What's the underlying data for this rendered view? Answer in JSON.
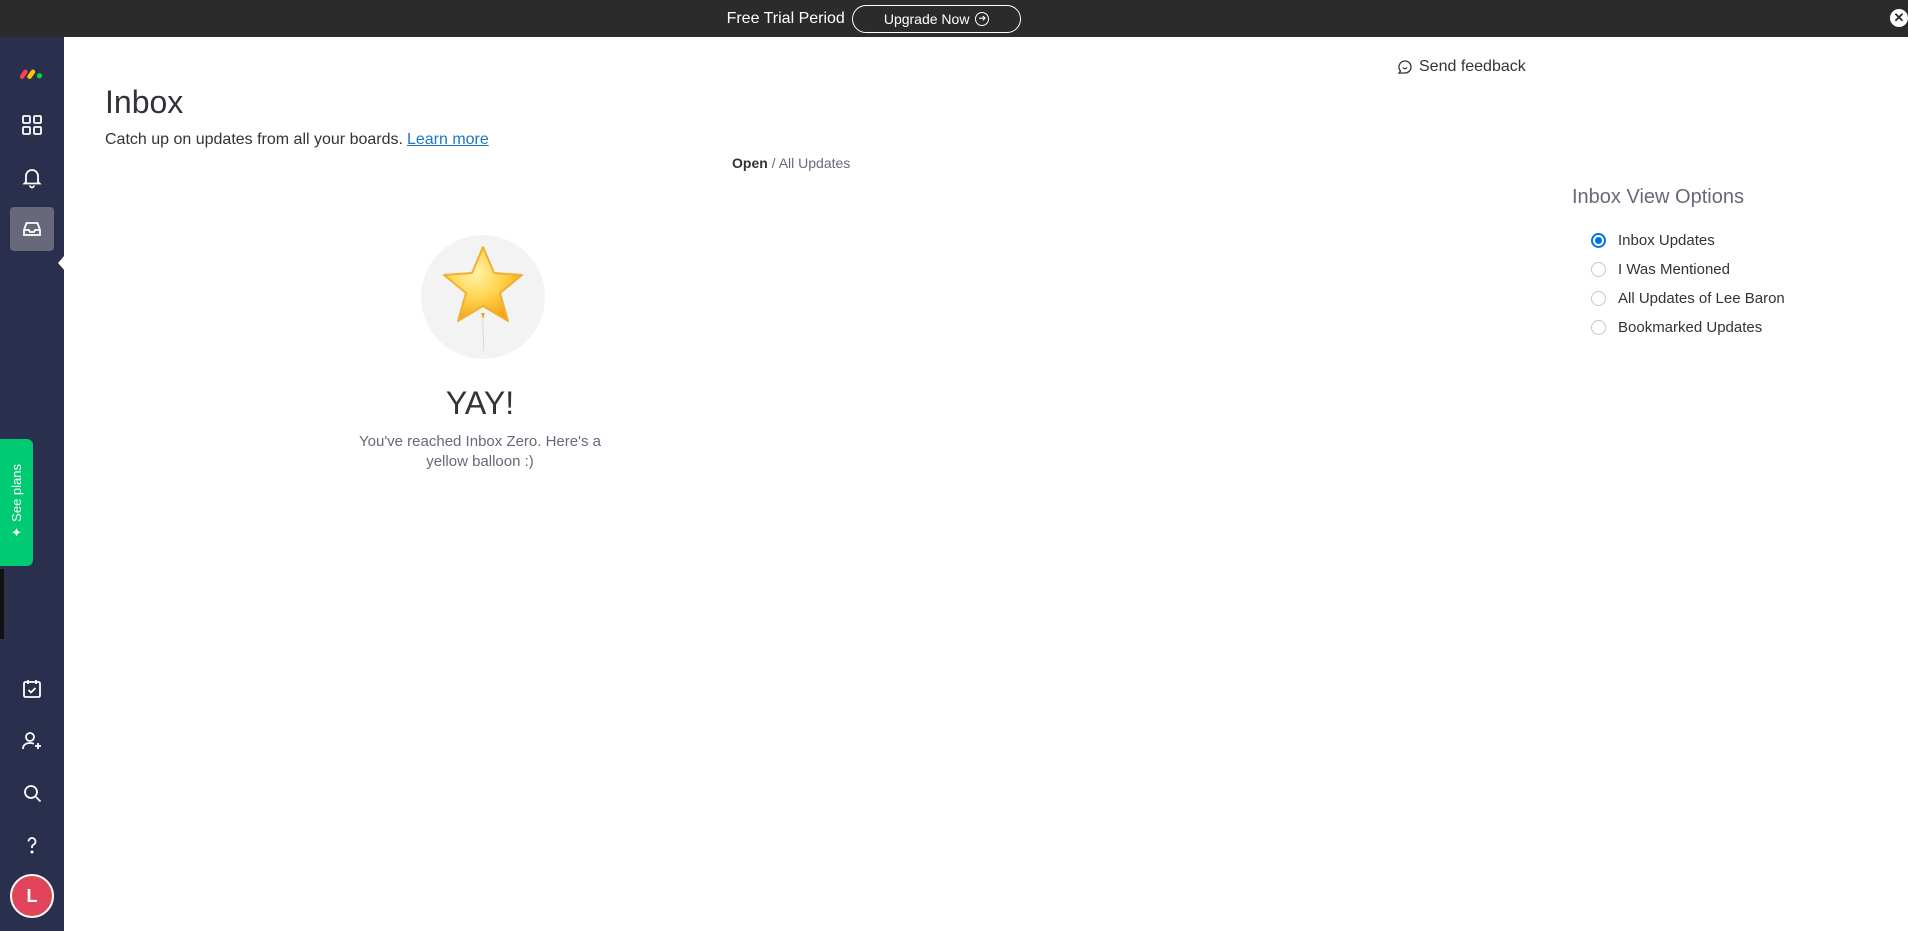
{
  "trial_bar": {
    "text": "Free Trial Period",
    "upgrade_label": "Upgrade Now",
    "close_icon": "close-icon"
  },
  "sidebar": {
    "items": [
      {
        "name": "logo",
        "icon": "monday-logo"
      },
      {
        "name": "workspace",
        "icon": "grid-icon"
      },
      {
        "name": "notifications",
        "icon": "bell-icon"
      },
      {
        "name": "inbox",
        "icon": "inbox-icon",
        "active": true
      },
      {
        "name": "my-work",
        "icon": "calendar-check-icon"
      },
      {
        "name": "invite",
        "icon": "user-plus-icon"
      },
      {
        "name": "search",
        "icon": "search-icon"
      },
      {
        "name": "help",
        "icon": "question-icon"
      }
    ],
    "see_plans_label": "See plans",
    "avatar_initial": "L"
  },
  "header": {
    "feedback_label": "Send feedback",
    "title": "Inbox",
    "subtitle": "Catch up on updates from all your boards.",
    "learn_more": "Learn more"
  },
  "filter": {
    "current": "Open",
    "separator": "/",
    "scope": "All Updates"
  },
  "empty_state": {
    "title": "YAY!",
    "message": "You've reached Inbox Zero. Here's a yellow balloon :)"
  },
  "view_options": {
    "title": "Inbox View Options",
    "options": [
      {
        "label": "Inbox Updates",
        "selected": true
      },
      {
        "label": "I Was Mentioned",
        "selected": false
      },
      {
        "label": "All Updates of Lee Baron",
        "selected": false
      },
      {
        "label": "Bookmarked Updates",
        "selected": false
      }
    ]
  },
  "colors": {
    "sidebar_bg": "#292f4c",
    "accent": "#0073ea",
    "see_plans": "#00ca72",
    "avatar": "#e2445c"
  }
}
